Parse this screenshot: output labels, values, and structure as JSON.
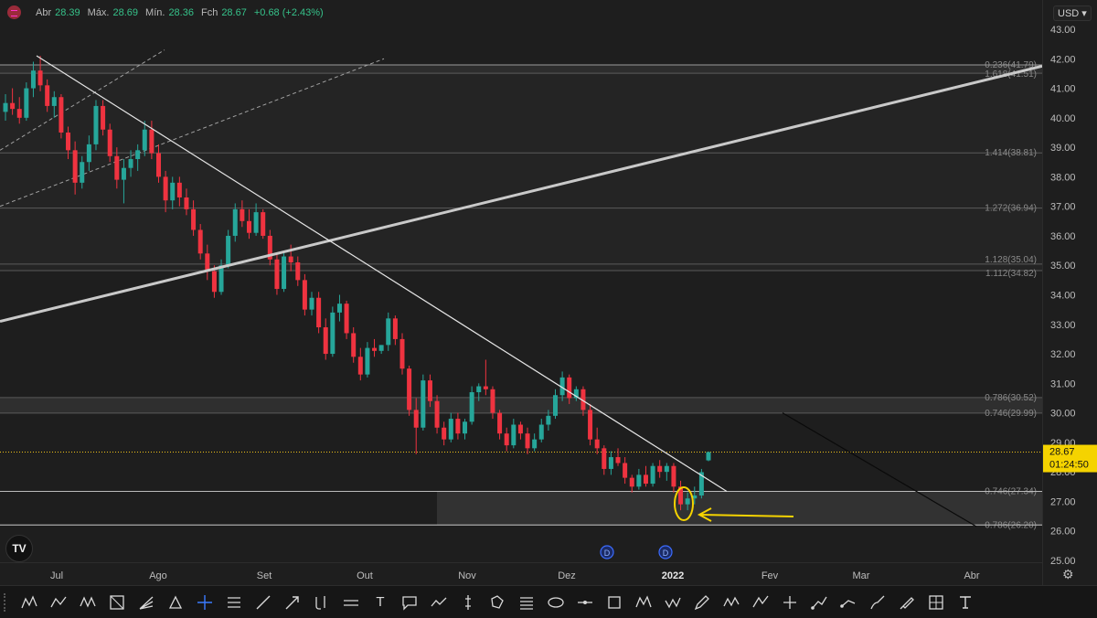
{
  "legend": {
    "open_label": "Abr",
    "open": "28.39",
    "high_label": "Máx.",
    "high": "28.69",
    "low_label": "Mín.",
    "low": "28.36",
    "close_label": "Fch",
    "close": "28.67",
    "change": "+0.68 (+2.43%)"
  },
  "currency": "USD",
  "last_price": "28.67",
  "countdown": "01:24:50",
  "logo": "TV",
  "colors": {
    "up": "#26a69a",
    "down": "#ef3340",
    "price_line": "#f0c419",
    "annotation": "#f5d300",
    "last_price_bg": "#f5d300"
  },
  "chart_data": {
    "type": "candlestick",
    "ylim": [
      25.0,
      43.0
    ],
    "y_ticks": [
      "43.00",
      "42.00",
      "41.00",
      "40.00",
      "39.00",
      "38.00",
      "37.00",
      "36.00",
      "35.00",
      "34.00",
      "33.00",
      "32.00",
      "31.00",
      "30.00",
      "29.00",
      "28.00",
      "27.00",
      "26.00",
      "25.00"
    ],
    "x_labels": [
      "Jul",
      "Ago",
      "Set",
      "Out",
      "Nov",
      "Dez",
      "2022",
      "Fev",
      "Mar",
      "Abr"
    ],
    "fib_levels": [
      {
        "label": "0.236(41.79)",
        "value": 41.79
      },
      {
        "label": "1.618(41.51)",
        "value": 41.51
      },
      {
        "label": "1.414(38.81)",
        "value": 38.81
      },
      {
        "label": "1.272(36.94)",
        "value": 36.94
      },
      {
        "label": "1.128(35.04)",
        "value": 35.04
      },
      {
        "label": "1.112(34.82)",
        "value": 34.82
      },
      {
        "label": "0.786(30.52)",
        "value": 30.52
      },
      {
        "label": "0.746(29.99)",
        "value": 29.99
      },
      {
        "label": "0.746(27.34)",
        "value": 27.34
      },
      {
        "label": "0.786(26.20)",
        "value": 26.2
      }
    ],
    "dividend_markers": [
      "D",
      "D"
    ],
    "candles": [
      [
        40.2,
        40.8,
        39.9,
        40.5
      ],
      [
        40.5,
        41.0,
        40.1,
        40.3
      ],
      [
        40.3,
        40.7,
        39.8,
        40.0
      ],
      [
        40.0,
        41.2,
        39.9,
        41.0
      ],
      [
        41.0,
        41.9,
        40.7,
        41.6
      ],
      [
        41.6,
        42.1,
        40.9,
        41.1
      ],
      [
        41.1,
        41.3,
        40.2,
        40.4
      ],
      [
        40.4,
        40.9,
        40.0,
        40.7
      ],
      [
        40.7,
        40.8,
        39.3,
        39.5
      ],
      [
        39.5,
        39.7,
        38.6,
        38.9
      ],
      [
        38.9,
        39.2,
        37.4,
        37.8
      ],
      [
        37.8,
        38.7,
        37.6,
        38.5
      ],
      [
        38.5,
        39.4,
        38.2,
        39.1
      ],
      [
        39.1,
        40.6,
        38.9,
        40.4
      ],
      [
        40.4,
        40.6,
        39.4,
        39.6
      ],
      [
        39.6,
        39.8,
        38.5,
        38.7
      ],
      [
        38.7,
        39.0,
        37.6,
        37.9
      ],
      [
        37.9,
        38.6,
        37.1,
        38.3
      ],
      [
        38.3,
        38.9,
        38.0,
        38.6
      ],
      [
        38.6,
        39.1,
        38.2,
        38.9
      ],
      [
        38.9,
        39.9,
        38.7,
        39.6
      ],
      [
        39.6,
        39.9,
        38.6,
        38.8
      ],
      [
        38.8,
        39.1,
        37.8,
        38.0
      ],
      [
        38.0,
        38.2,
        36.8,
        37.2
      ],
      [
        37.2,
        38.0,
        36.9,
        37.8
      ],
      [
        37.8,
        38.0,
        37.0,
        37.3
      ],
      [
        37.3,
        37.6,
        36.7,
        36.9
      ],
      [
        36.9,
        37.2,
        36.0,
        36.2
      ],
      [
        36.2,
        36.4,
        35.2,
        35.4
      ],
      [
        35.4,
        35.7,
        34.5,
        34.8
      ],
      [
        34.8,
        35.0,
        33.9,
        34.1
      ],
      [
        34.1,
        35.2,
        34.0,
        35.0
      ],
      [
        35.0,
        36.2,
        34.9,
        36.0
      ],
      [
        36.0,
        37.1,
        35.8,
        36.9
      ],
      [
        36.9,
        37.2,
        36.3,
        36.5
      ],
      [
        36.5,
        36.9,
        35.9,
        36.1
      ],
      [
        36.1,
        37.1,
        36.0,
        36.8
      ],
      [
        36.8,
        36.9,
        35.9,
        36.0
      ],
      [
        36.0,
        36.2,
        35.0,
        35.2
      ],
      [
        35.2,
        35.4,
        34.0,
        34.2
      ],
      [
        34.2,
        35.5,
        34.1,
        35.3
      ],
      [
        35.3,
        35.7,
        34.8,
        35.1
      ],
      [
        35.1,
        35.3,
        34.3,
        34.5
      ],
      [
        34.5,
        34.7,
        33.3,
        33.5
      ],
      [
        33.5,
        34.1,
        33.3,
        33.9
      ],
      [
        33.9,
        34.1,
        32.7,
        32.9
      ],
      [
        32.9,
        33.2,
        31.8,
        32.0
      ],
      [
        32.0,
        33.6,
        31.9,
        33.4
      ],
      [
        33.4,
        34.0,
        33.1,
        33.7
      ],
      [
        33.7,
        33.8,
        32.5,
        32.7
      ],
      [
        32.7,
        32.9,
        31.7,
        31.9
      ],
      [
        31.9,
        32.2,
        31.1,
        31.3
      ],
      [
        31.3,
        32.4,
        31.2,
        32.2
      ],
      [
        32.2,
        32.5,
        31.9,
        32.1
      ],
      [
        32.1,
        32.3,
        32.0,
        32.3
      ],
      [
        32.3,
        33.4,
        32.1,
        33.2
      ],
      [
        33.2,
        33.3,
        32.3,
        32.5
      ],
      [
        32.5,
        32.7,
        31.3,
        31.5
      ],
      [
        31.5,
        31.6,
        29.9,
        30.1
      ],
      [
        30.1,
        30.5,
        28.6,
        29.5
      ],
      [
        29.5,
        31.3,
        29.4,
        31.1
      ],
      [
        31.1,
        31.3,
        30.2,
        30.4
      ],
      [
        30.4,
        30.6,
        29.3,
        29.5
      ],
      [
        29.5,
        29.7,
        28.9,
        29.1
      ],
      [
        29.1,
        30.0,
        29.0,
        29.8
      ],
      [
        29.8,
        30.0,
        29.1,
        29.3
      ],
      [
        29.3,
        29.8,
        29.1,
        29.7
      ],
      [
        29.7,
        30.9,
        29.6,
        30.7
      ],
      [
        30.7,
        31.0,
        30.4,
        30.9
      ],
      [
        30.9,
        31.8,
        30.6,
        30.8
      ],
      [
        30.8,
        30.9,
        29.8,
        30.0
      ],
      [
        30.0,
        30.1,
        29.1,
        29.3
      ],
      [
        29.3,
        29.5,
        28.7,
        28.9
      ],
      [
        28.9,
        29.8,
        28.8,
        29.6
      ],
      [
        29.6,
        29.7,
        29.1,
        29.3
      ],
      [
        29.3,
        29.5,
        28.6,
        28.8
      ],
      [
        28.8,
        29.3,
        28.7,
        29.1
      ],
      [
        29.1,
        29.8,
        29.0,
        29.6
      ],
      [
        29.6,
        30.1,
        29.4,
        29.9
      ],
      [
        29.9,
        30.8,
        29.8,
        30.6
      ],
      [
        30.6,
        31.4,
        30.4,
        31.2
      ],
      [
        31.2,
        31.3,
        30.3,
        30.5
      ],
      [
        30.5,
        30.9,
        30.4,
        30.8
      ],
      [
        30.8,
        30.9,
        29.9,
        30.1
      ],
      [
        30.1,
        30.3,
        28.9,
        29.1
      ],
      [
        29.1,
        29.5,
        28.6,
        28.8
      ],
      [
        28.8,
        28.9,
        27.9,
        28.1
      ],
      [
        28.1,
        28.7,
        27.9,
        28.5
      ],
      [
        28.5,
        28.8,
        28.2,
        28.3
      ],
      [
        28.3,
        28.5,
        27.6,
        27.8
      ],
      [
        27.8,
        27.9,
        27.3,
        27.5
      ],
      [
        27.5,
        28.1,
        27.4,
        27.9
      ],
      [
        27.9,
        28.2,
        27.5,
        27.6
      ],
      [
        27.6,
        28.3,
        27.5,
        28.2
      ],
      [
        28.2,
        28.4,
        27.8,
        28.0
      ],
      [
        28.0,
        28.3,
        27.7,
        28.2
      ],
      [
        28.2,
        28.3,
        27.3,
        27.5
      ],
      [
        27.5,
        27.7,
        26.7,
        26.9
      ],
      [
        26.9,
        27.3,
        26.7,
        27.1
      ],
      [
        27.1,
        27.5,
        26.9,
        27.2
      ],
      [
        27.2,
        28.1,
        27.1,
        27.99
      ],
      [
        28.39,
        28.69,
        28.36,
        28.67
      ]
    ]
  }
}
